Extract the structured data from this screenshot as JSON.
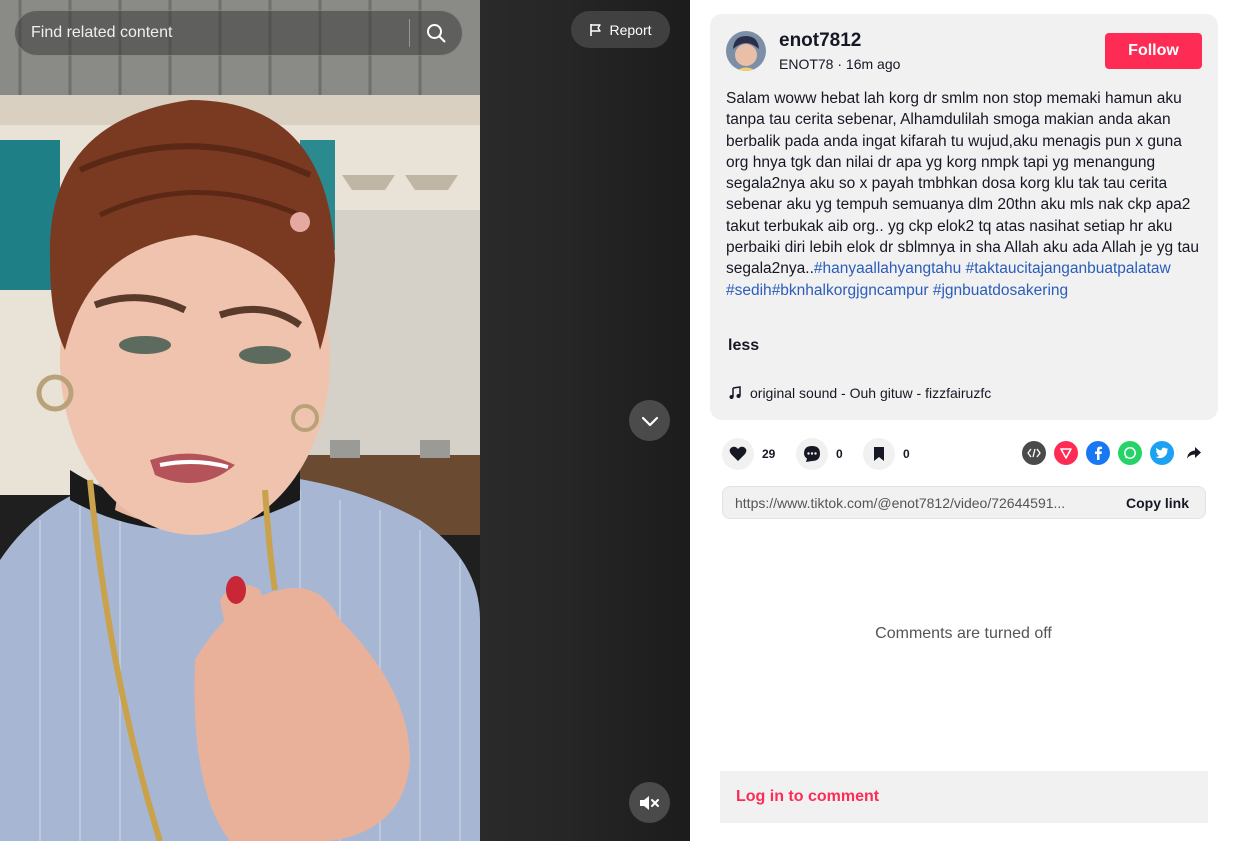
{
  "search": {
    "placeholder": "Find related content"
  },
  "video": {
    "report_label": "Report"
  },
  "author": {
    "username": "enot7812",
    "nickname": "ENOT78",
    "time_ago": "16m ago",
    "separator": " · "
  },
  "follow_label": "Follow",
  "description": {
    "text": "Salam woww hebat lah korg dr smlm non stop memaki hamun aku tanpa tau cerita sebenar, Alhamdulilah smoga makian anda akan berbalik pada anda ingat kifarah tu wujud,aku menagis pun x guna org hnya tgk dan nilai dr apa yg korg nmpk tapi yg menangung segala2nya aku so x payah tmbhkan dosa korg klu tak tau cerita sebenar aku yg tempuh semuanya dlm 20thn aku mls nak ckp apa2 takut terbukak aib org.. yg ckp elok2 tq atas nasihat setiap hr aku perbaiki diri lebih elok dr sblmnya in sha Allah aku ada Allah je yg tau segala2nya..",
    "hashtags": [
      "#hanyaallahyangtahu",
      "#taktaucitajanganbuatpalataw",
      "#sedih",
      "#bknhalkorgjgncampur",
      "#jgnbuatdosakering"
    ],
    "less_label": "less"
  },
  "music": {
    "label": "original sound - Ouh gituw - fizzfairuzfc"
  },
  "actions": {
    "likes": "29",
    "comments": "0",
    "saves": "0"
  },
  "share": {
    "icons": [
      "embed-icon",
      "send-to-friends-icon",
      "facebook-icon",
      "whatsapp-icon",
      "twitter-icon",
      "share-arrow-icon"
    ],
    "colors": {
      "embed": "#4a4a4a",
      "send": "#fe2c55",
      "facebook": "#1877f2",
      "whatsapp": "#25d366",
      "twitter": "#1da1f2"
    }
  },
  "link": {
    "url": "https://www.tiktok.com/@enot7812/video/72644591...",
    "copy_label": "Copy link"
  },
  "comments": {
    "off_text": "Comments are turned off",
    "login_label": "Log in to comment"
  },
  "colors": {
    "accent": "#fe2c55",
    "hashtag": "#2b5db9",
    "card_bg": "#f1f1f2"
  }
}
